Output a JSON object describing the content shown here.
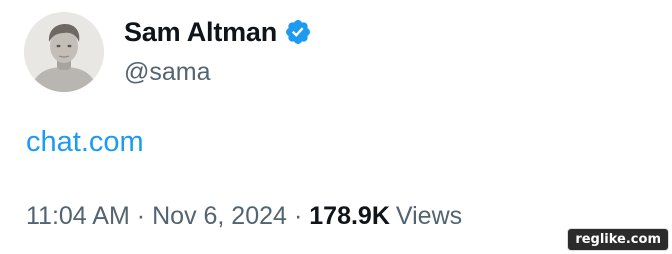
{
  "author": {
    "display_name": "Sam Altman",
    "handle": "@sama",
    "verified": true,
    "avatar_icon": "profile-photo"
  },
  "tweet": {
    "text_link": "chat.com"
  },
  "meta": {
    "time": "11:04 AM",
    "separator": "·",
    "date": "Nov 6, 2024",
    "views_count": "178.9K",
    "views_label": "Views"
  },
  "watermark": {
    "text": "reglike.com"
  },
  "colors": {
    "link": "#1d9bf0",
    "verified_badge": "#1d9bf0",
    "secondary_text": "#536471",
    "primary_text": "#0f1419"
  }
}
